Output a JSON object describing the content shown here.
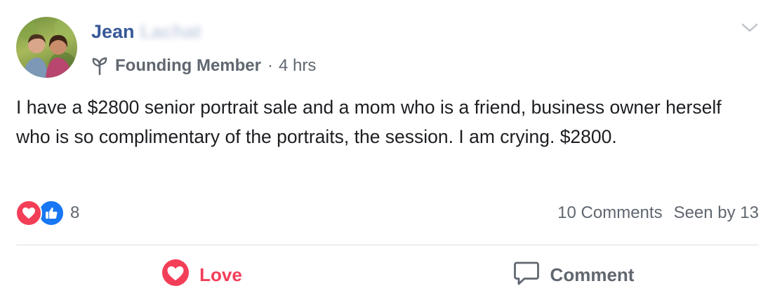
{
  "post": {
    "author": {
      "first_name": "Jean",
      "last_name": "Lachat",
      "badge_icon": "sprout-icon",
      "badge_label": "Founding Member",
      "separator": "·",
      "time": "4 hrs"
    },
    "body": "I have a $2800 senior portrait sale and a mom who is a friend, business owner herself who is so complimentary of the portraits, the session. I am crying. $2800.",
    "reactions": {
      "icons": [
        "love-reaction-icon",
        "like-reaction-icon"
      ],
      "count": "8"
    },
    "stats": {
      "comments": "10 Comments",
      "seen_by": "Seen by 13"
    },
    "actions": {
      "love_label": "Love",
      "comment_label": "Comment"
    },
    "colors": {
      "name_blue": "#385898",
      "love_red": "#f33e58",
      "like_blue": "#1877f2",
      "muted_gray": "#606770",
      "divider": "#dadde1"
    }
  }
}
